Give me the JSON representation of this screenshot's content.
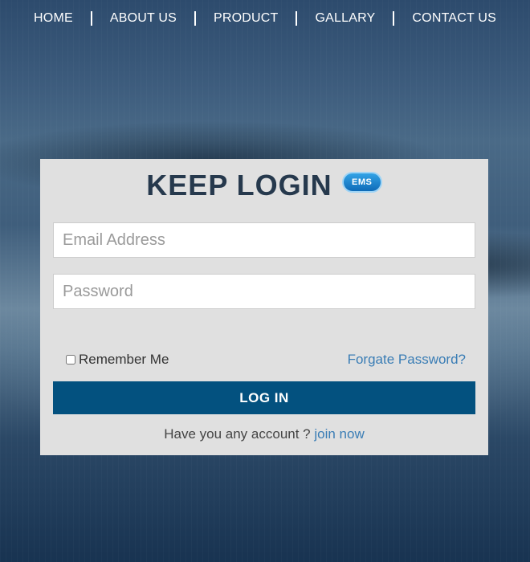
{
  "nav": {
    "items": [
      {
        "label": "HOME"
      },
      {
        "label": "ABOUT US"
      },
      {
        "label": "PRODUCT"
      },
      {
        "label": "GALLARY"
      },
      {
        "label": "CONTACT US"
      }
    ]
  },
  "login": {
    "title": "KEEP LOGIN",
    "logo_text": "EMS",
    "email_placeholder": "Email Address",
    "password_placeholder": "Password",
    "remember_label": "Remember Me",
    "forgot_label": "Forgate Password?",
    "submit_label": "LOG IN",
    "signup_prompt": "Have you any account ?",
    "signup_link": "join now"
  },
  "colors": {
    "button": "#03517f",
    "link": "#3a7db5",
    "panel": "#e0e0e0",
    "title": "#26394d"
  }
}
